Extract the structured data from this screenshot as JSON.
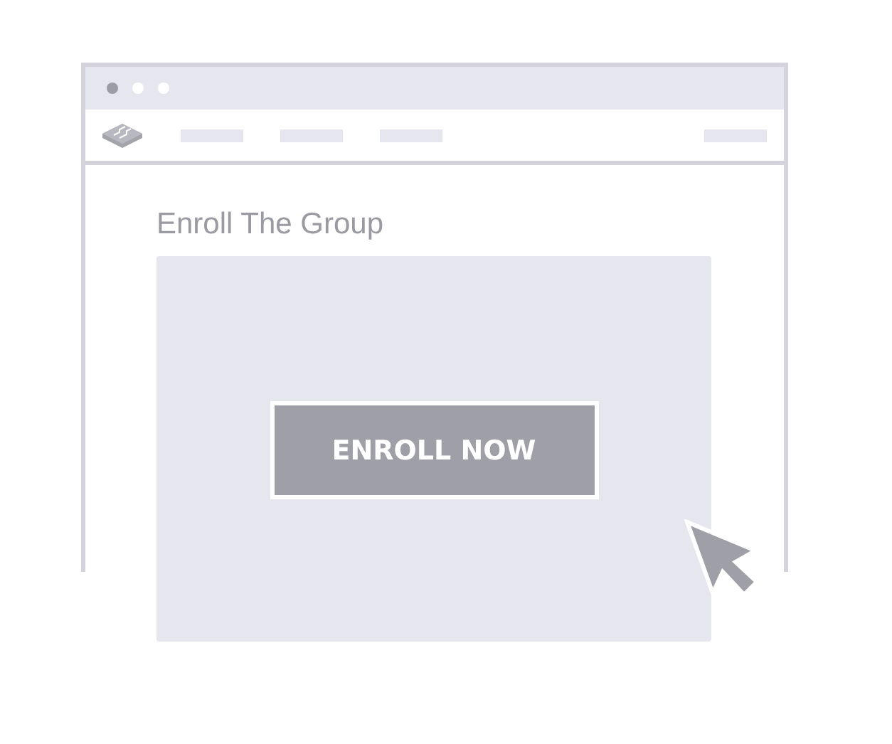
{
  "heading": "Enroll The Group",
  "button": "ENROLL NOW"
}
